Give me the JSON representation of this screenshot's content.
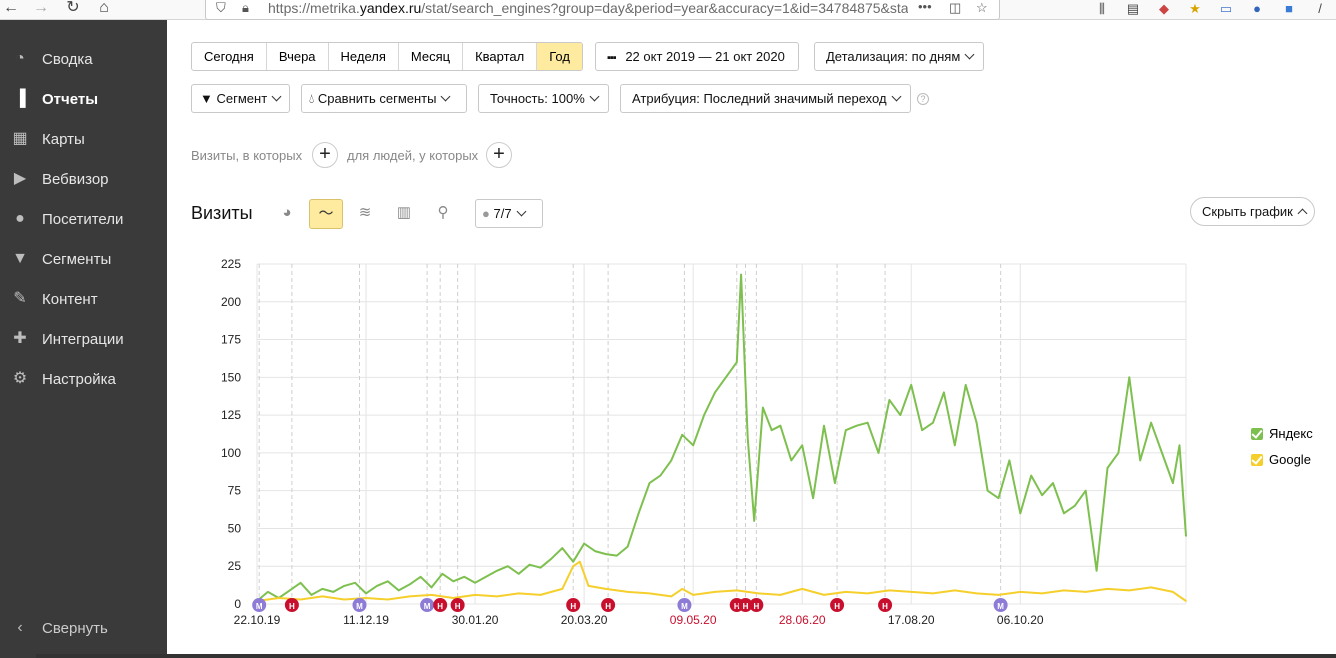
{
  "browser": {
    "url_prefix": "https://metrika.",
    "url_domain": "yandex.ru",
    "url_rest": "/stat/search_engines?group=day&period=year&accuracy=1&id=34784875&sta",
    "more": "•••"
  },
  "sidebar": {
    "items": [
      {
        "label": "Сводка",
        "icon": "gauge-icon"
      },
      {
        "label": "Отчеты",
        "icon": "bar-chart-icon"
      },
      {
        "label": "Карты",
        "icon": "map-icon"
      },
      {
        "label": "Вебвизор",
        "icon": "play-icon"
      },
      {
        "label": "Посетители",
        "icon": "user-icon"
      },
      {
        "label": "Сегменты",
        "icon": "funnel-icon"
      },
      {
        "label": "Контент",
        "icon": "pencil-icon"
      },
      {
        "label": "Интеграции",
        "icon": "puzzle-icon"
      },
      {
        "label": "Настройка",
        "icon": "gear-icon"
      }
    ],
    "collapse_label": "Свернуть"
  },
  "periods": [
    "Сегодня",
    "Вчера",
    "Неделя",
    "Месяц",
    "Квартал",
    "Год"
  ],
  "active_period": "Год",
  "date_range": "22 окт 2019 — 21 окт 2020",
  "detail": "Детализация: по дням",
  "filters": {
    "segment": "Сегмент",
    "compare": "Сравнить сегменты",
    "accuracy": "Точность: 100%",
    "attribution": "Атрибуция: Последний значимый переход"
  },
  "conditions": {
    "visits_label": "Визиты, в которых",
    "people_label": "для людей, у которых"
  },
  "chart_header": {
    "title": "Визиты",
    "notes_count": "7/7",
    "hide_button": "Скрыть график"
  },
  "chart_data": {
    "type": "line",
    "ylim": [
      0,
      225
    ],
    "yticks": [
      "0",
      "25",
      "50",
      "75",
      "100",
      "125",
      "150",
      "175",
      "200",
      "225"
    ],
    "x_labels": [
      {
        "label": "22.10.19",
        "day": 0,
        "highlight": false
      },
      {
        "label": "11.12.19",
        "day": 50,
        "highlight": false
      },
      {
        "label": "30.01.20",
        "day": 100,
        "highlight": false
      },
      {
        "label": "20.03.20",
        "day": 150,
        "highlight": false
      },
      {
        "label": "09.05.20",
        "day": 200,
        "highlight": true
      },
      {
        "label": "28.06.20",
        "day": 250,
        "highlight": true
      },
      {
        "label": "17.08.20",
        "day": 300,
        "highlight": false
      },
      {
        "label": "06.10.20",
        "day": 350,
        "highlight": false
      }
    ],
    "grid": true,
    "legend_position": "right",
    "series": [
      {
        "name": "Яндекс",
        "color": "#7ec04f",
        "points": [
          [
            0,
            2
          ],
          [
            5,
            8
          ],
          [
            10,
            4
          ],
          [
            15,
            9
          ],
          [
            20,
            14
          ],
          [
            25,
            6
          ],
          [
            30,
            10
          ],
          [
            35,
            8
          ],
          [
            40,
            12
          ],
          [
            45,
            14
          ],
          [
            50,
            7
          ],
          [
            55,
            12
          ],
          [
            60,
            15
          ],
          [
            65,
            9
          ],
          [
            70,
            13
          ],
          [
            75,
            18
          ],
          [
            80,
            11
          ],
          [
            85,
            20
          ],
          [
            90,
            15
          ],
          [
            95,
            18
          ],
          [
            100,
            14
          ],
          [
            105,
            18
          ],
          [
            110,
            22
          ],
          [
            115,
            25
          ],
          [
            120,
            20
          ],
          [
            125,
            26
          ],
          [
            130,
            24
          ],
          [
            135,
            30
          ],
          [
            140,
            37
          ],
          [
            145,
            28
          ],
          [
            150,
            40
          ],
          [
            155,
            35
          ],
          [
            160,
            33
          ],
          [
            165,
            32
          ],
          [
            170,
            38
          ],
          [
            175,
            60
          ],
          [
            180,
            80
          ],
          [
            185,
            85
          ],
          [
            190,
            95
          ],
          [
            195,
            112
          ],
          [
            200,
            105
          ],
          [
            205,
            125
          ],
          [
            210,
            140
          ],
          [
            215,
            150
          ],
          [
            220,
            160
          ],
          [
            222,
            218
          ],
          [
            225,
            110
          ],
          [
            228,
            55
          ],
          [
            232,
            130
          ],
          [
            236,
            115
          ],
          [
            240,
            118
          ],
          [
            245,
            95
          ],
          [
            250,
            105
          ],
          [
            255,
            70
          ],
          [
            260,
            118
          ],
          [
            265,
            80
          ],
          [
            270,
            115
          ],
          [
            275,
            118
          ],
          [
            280,
            120
          ],
          [
            285,
            100
          ],
          [
            290,
            135
          ],
          [
            295,
            125
          ],
          [
            300,
            145
          ],
          [
            305,
            115
          ],
          [
            310,
            120
          ],
          [
            315,
            140
          ],
          [
            320,
            105
          ],
          [
            325,
            145
          ],
          [
            330,
            120
          ],
          [
            335,
            75
          ],
          [
            340,
            70
          ],
          [
            345,
            95
          ],
          [
            350,
            60
          ],
          [
            355,
            85
          ],
          [
            360,
            72
          ],
          [
            365,
            80
          ],
          [
            370,
            60
          ],
          [
            375,
            65
          ],
          [
            380,
            75
          ],
          [
            385,
            22
          ],
          [
            390,
            90
          ],
          [
            395,
            100
          ],
          [
            400,
            150
          ],
          [
            405,
            95
          ],
          [
            410,
            120
          ],
          [
            415,
            100
          ],
          [
            420,
            80
          ],
          [
            423,
            105
          ],
          [
            426,
            45
          ]
        ]
      },
      {
        "name": "Google",
        "color": "#f5cf2b",
        "points": [
          [
            0,
            2
          ],
          [
            10,
            4
          ],
          [
            20,
            3
          ],
          [
            30,
            5
          ],
          [
            40,
            3
          ],
          [
            50,
            4
          ],
          [
            60,
            3
          ],
          [
            70,
            5
          ],
          [
            80,
            6
          ],
          [
            90,
            4
          ],
          [
            100,
            6
          ],
          [
            110,
            5
          ],
          [
            120,
            7
          ],
          [
            130,
            6
          ],
          [
            140,
            10
          ],
          [
            145,
            25
          ],
          [
            148,
            28
          ],
          [
            152,
            12
          ],
          [
            160,
            10
          ],
          [
            170,
            8
          ],
          [
            180,
            7
          ],
          [
            190,
            5
          ],
          [
            195,
            10
          ],
          [
            200,
            6
          ],
          [
            210,
            8
          ],
          [
            220,
            9
          ],
          [
            230,
            7
          ],
          [
            240,
            6
          ],
          [
            250,
            10
          ],
          [
            260,
            6
          ],
          [
            270,
            8
          ],
          [
            280,
            7
          ],
          [
            290,
            9
          ],
          [
            300,
            8
          ],
          [
            310,
            7
          ],
          [
            320,
            9
          ],
          [
            330,
            7
          ],
          [
            340,
            6
          ],
          [
            350,
            8
          ],
          [
            360,
            7
          ],
          [
            370,
            9
          ],
          [
            380,
            8
          ],
          [
            390,
            10
          ],
          [
            400,
            9
          ],
          [
            410,
            11
          ],
          [
            420,
            8
          ],
          [
            426,
            2
          ]
        ]
      }
    ],
    "annotations": [
      {
        "label": "М",
        "color": "#8d7bd6",
        "day": 1
      },
      {
        "label": "Н",
        "color": "#c8102e",
        "day": 16
      },
      {
        "label": "М",
        "color": "#8d7bd6",
        "day": 47
      },
      {
        "label": "М",
        "color": "#8d7bd6",
        "day": 78
      },
      {
        "label": "Н",
        "color": "#c8102e",
        "day": 84
      },
      {
        "label": "Н",
        "color": "#c8102e",
        "day": 92
      },
      {
        "label": "Н",
        "color": "#c8102e",
        "day": 145
      },
      {
        "label": "Н",
        "color": "#c8102e",
        "day": 161
      },
      {
        "label": "М",
        "color": "#8d7bd6",
        "day": 196
      },
      {
        "label": "Н",
        "color": "#c8102e",
        "day": 220
      },
      {
        "label": "Н",
        "color": "#c8102e",
        "day": 224
      },
      {
        "label": "Н",
        "color": "#c8102e",
        "day": 229
      },
      {
        "label": "Н",
        "color": "#c8102e",
        "day": 266
      },
      {
        "label": "Н",
        "color": "#c8102e",
        "day": 288
      },
      {
        "label": "М",
        "color": "#8d7bd6",
        "day": 341
      }
    ]
  },
  "legend": [
    {
      "name": "Яндекс",
      "color": "#7ec04f"
    },
    {
      "name": "Google",
      "color": "#f5cf2b"
    }
  ]
}
